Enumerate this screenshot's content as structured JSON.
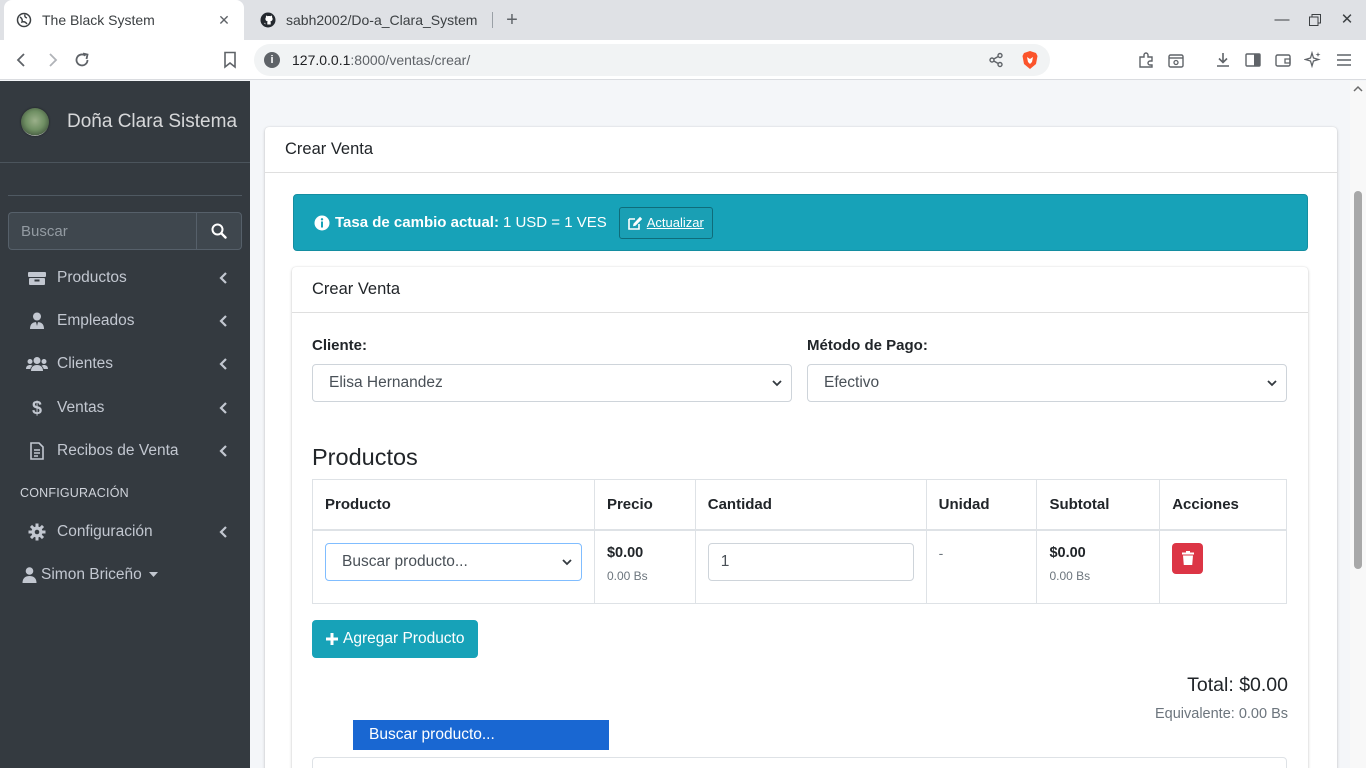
{
  "browser": {
    "tabs": [
      {
        "title": "The Black System",
        "active": true
      },
      {
        "title": "sabh2002/Do-a_Clara_System",
        "active": false
      }
    ],
    "url_host": "127.0.0.1",
    "url_rest": ":8000/ventas/crear/"
  },
  "sidebar": {
    "brand": "Doña Clara Sistema",
    "search_placeholder": "Buscar",
    "items": [
      {
        "label": "Productos",
        "icon": "boxes-icon"
      },
      {
        "label": "Empleados",
        "icon": "user-tie-icon"
      },
      {
        "label": "Clientes",
        "icon": "users-icon"
      },
      {
        "label": "Ventas",
        "icon": "dollar-icon"
      },
      {
        "label": "Recibos de Venta",
        "icon": "file-invoice-icon"
      }
    ],
    "section_header": "CONFIGURACIÓN",
    "config_item": {
      "label": "Configuración",
      "icon": "cog-icon"
    },
    "user": "Simon Briceño"
  },
  "page": {
    "card_title": "Crear Venta",
    "alert": {
      "bold": "Tasa de cambio actual:",
      "rate": "1 USD = 1 VES",
      "button": "Actualizar"
    },
    "form": {
      "title": "Crear Venta",
      "cliente_label": "Cliente:",
      "cliente_value": "Elisa Hernandez",
      "metodo_label": "Método de Pago:",
      "metodo_value": "Efectivo"
    },
    "products": {
      "title": "Productos",
      "headers": [
        "Producto",
        "Precio",
        "Cantidad",
        "Unidad",
        "Subtotal",
        "Acciones"
      ],
      "row": {
        "product_select": "Buscar producto...",
        "price": "$0.00",
        "price_bs": "0.00 Bs",
        "quantity": "1",
        "unit": "-",
        "subtotal": "$0.00",
        "subtotal_bs": "0.00 Bs"
      },
      "dropdown_option": "Buscar producto..."
    },
    "add_button": "Agregar Producto",
    "total": "Total: $0.00",
    "equivalent": "Equivalente: 0.00 Bs"
  },
  "colors": {
    "sidebar_bg": "#343a40",
    "info": "#17a2b8",
    "danger": "#dc3545",
    "select_highlight": "#1967d2"
  }
}
